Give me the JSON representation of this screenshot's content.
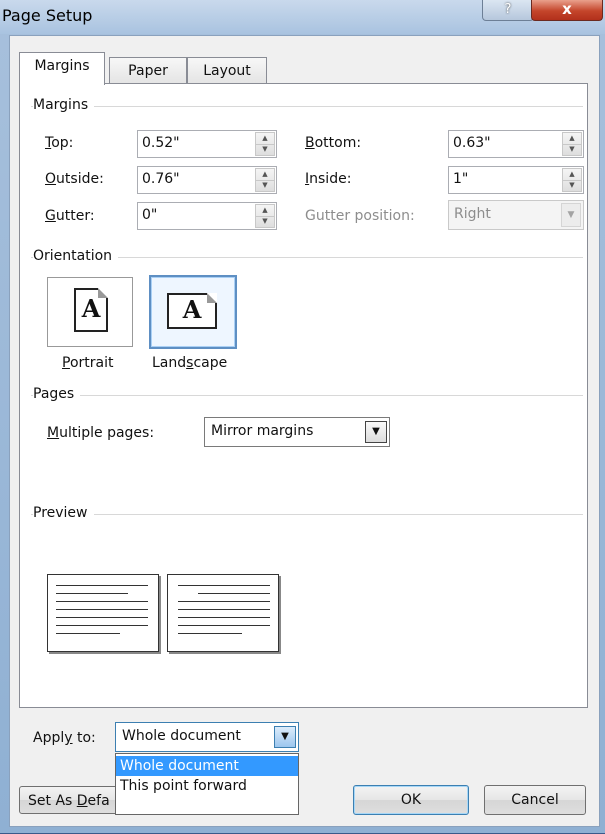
{
  "window": {
    "title": "Page Setup",
    "help_glyph": "?",
    "close_glyph": "x"
  },
  "tabs": [
    {
      "label": "Margins",
      "active": true
    },
    {
      "label": "Paper",
      "active": false
    },
    {
      "label": "Layout",
      "active": false
    }
  ],
  "margins": {
    "section_label": "Margins",
    "top": {
      "label_hot": "T",
      "label_rest": "op:",
      "value": "0.52\""
    },
    "bottom": {
      "label_hot": "B",
      "label_rest": "ottom:",
      "value": "0.63\""
    },
    "outside": {
      "label_hot": "O",
      "label_rest": "utside:",
      "value": "0.76\""
    },
    "inside": {
      "label_hot": "I",
      "label_rest": "nside:",
      "value": "1\""
    },
    "gutter": {
      "label_hot": "G",
      "label_rest": "utter:",
      "value": "0\""
    },
    "gutter_position": {
      "label": "Gutter position:",
      "value": "Right",
      "enabled": false
    }
  },
  "orientation": {
    "section_label": "Orientation",
    "portrait_label_hot": "P",
    "portrait_label_rest": "ortrait",
    "landscape_label_pre": "Land",
    "landscape_label_hot": "s",
    "landscape_label_post": "cape",
    "icon_letter": "A",
    "selected": "Landscape"
  },
  "pages": {
    "section_label": "Pages",
    "multiple_label_hot": "M",
    "multiple_label_rest": "ultiple pages:",
    "multiple_value": "Mirror margins"
  },
  "preview": {
    "section_label": "Preview"
  },
  "apply_to": {
    "label_pre": "Appl",
    "label_hot": "y",
    "label_post": " to:",
    "value": "Whole document",
    "options": [
      {
        "label": "Whole document",
        "selected": true
      },
      {
        "label": "This point forward",
        "selected": false
      }
    ]
  },
  "buttons": {
    "set_default_pre": "Set As ",
    "set_default_hot": "D",
    "set_default_post": "efa",
    "ok": "OK",
    "cancel": "Cancel"
  },
  "colors": {
    "selection": "#3399ff",
    "close_button": "#c4452b"
  },
  "icons": {
    "spin_up": "▲",
    "spin_down": "▼",
    "dropdown": "▼"
  }
}
